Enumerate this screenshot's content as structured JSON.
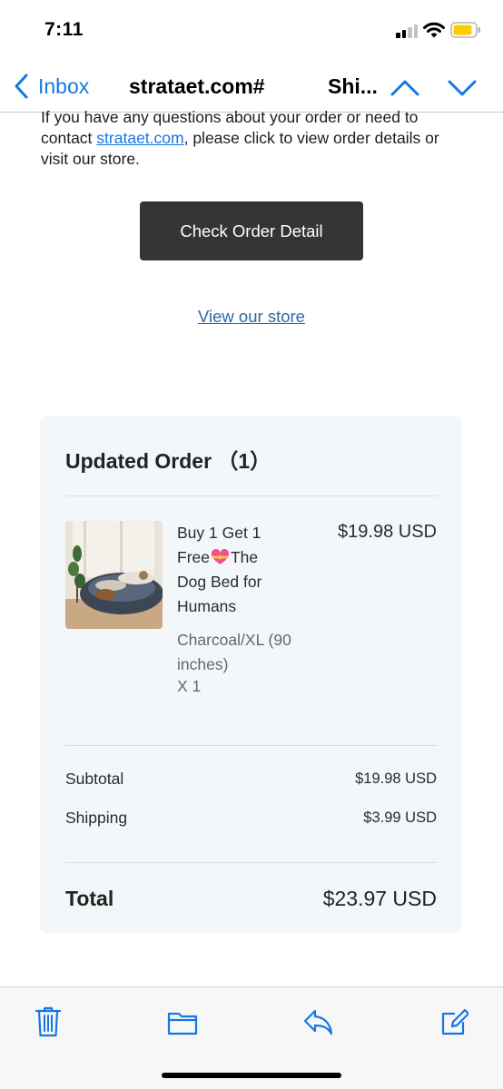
{
  "status_bar": {
    "time": "7:11",
    "signal_icon": "cellular-signal-icon",
    "wifi_icon": "wifi-icon",
    "battery_icon": "battery-low-icon",
    "battery_color": "#ffcc00"
  },
  "nav": {
    "back_label": "Inbox",
    "subject": "strataet.com#",
    "subject_tail": "Shi...",
    "up_icon": "chevron-up-icon",
    "down_icon": "chevron-down-icon",
    "accent_color": "#1577e6"
  },
  "email": {
    "intro_part1": "If you have any questions about your order or need to contact ",
    "intro_link": "strataet.com",
    "intro_part2": ", please click to view order details or visit our store.",
    "check_button": "Check Order Detail",
    "store_link": "View our store"
  },
  "order": {
    "title": "Updated Order （1）",
    "item": {
      "image_icon": "dog-bed-product-image",
      "name_part1": "Buy 1 Get 1 Free",
      "emoji": "heart-with-ribbon-emoji",
      "name_part2": "The Dog Bed for Humans",
      "price": "$19.98 USD",
      "variant": "Charcoal/XL (90 inches)",
      "quantity": "X 1"
    },
    "subtotal_label": "Subtotal",
    "subtotal_value": "$19.98 USD",
    "shipping_label": "Shipping",
    "shipping_value": "$3.99 USD",
    "total_label": "Total",
    "total_value": "$23.97 USD"
  },
  "toolbar": {
    "icons": [
      "trash-icon",
      "folder-icon",
      "reply-icon",
      "compose-icon"
    ]
  }
}
